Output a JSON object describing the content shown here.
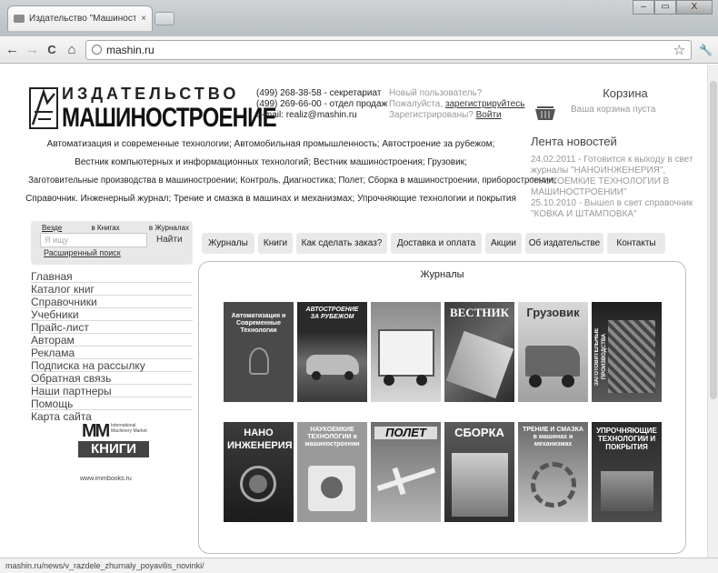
{
  "browser": {
    "tab_title": "Издательство \"Машиност",
    "tab_close": "×",
    "url": "mashin.ru",
    "status_url": "mashin.ru/news/v_razdele_zhurnaly_poyavilis_novinki/",
    "window_buttons": [
      "‒",
      "▭",
      "X"
    ]
  },
  "icons": {
    "back": "←",
    "forward": "→",
    "reload": "C",
    "home": "⌂",
    "star": "☆",
    "wrench": "🔧"
  },
  "header": {
    "logo_line1": "ИЗДАТЕЛЬСТВО",
    "logo_line2": "МАШИНОСТРОЕНИЕ",
    "phone1": "(499) 268-38-58 - секретариат",
    "phone2": "(499) 269-66-00 - отдел продаж",
    "email": "e-mail: realiz@mashin.ru",
    "new_user": "Новый пользователь?",
    "please": "Пожалуйста,",
    "register": "зарегистрируйтесь",
    "registered": "Зарегистрированы?",
    "login": "Войти"
  },
  "cart": {
    "title": "Корзина",
    "empty_text": "Ваша корзина пуста"
  },
  "news": {
    "title": "Лента новостей",
    "items": [
      "24.02.2011 - Готовится к выходу в свет журналы \"НАНОИНЖЕНЕРИЯ\", \"НАУКОЕМКИЕ ТЕХНОЛОГИИ В МАШИНОСТРОЕНИИ\"",
      "25.10.2010 - Вышел в свет справочник \"КОВКА И ШТАМПОВКА\""
    ]
  },
  "topics": [
    "Автоматизация и современные технологии; Автомобильная промышленность; Автостроение за рубежом;",
    "Вестник компьютерных и информационных технологий; Вестник машиностроения; Грузовик;",
    "Заготовительные производства в машиностроении; Контроль. Диагностика; Полет; Сборка в машиностроении, приборостроении;",
    "Справочник. Инженерный журнал; Трение и смазка в машинах и механизмах; Упрочняющие технологии и покрытия"
  ],
  "search": {
    "scope_all": "Везде",
    "scope_books": "в Книгах",
    "scope_journals": "в Журналах",
    "placeholder": "Я ищу",
    "button": "Найти",
    "advanced": "Расширенный поиск"
  },
  "nav_tabs": [
    "Журналы",
    "Книги",
    "Как сделать заказ?",
    "Доставка и оплата",
    "Акции",
    "Об издательстве",
    "Контакты"
  ],
  "menu": [
    "Главная",
    "Каталог книг",
    "Справочники",
    "Учебники",
    "Прайс-лист",
    "Авторам",
    "Реклама",
    "Подписка на рассылку",
    "Обратная связь",
    "Наши партнеры",
    "Помощь",
    "Карта сайта"
  ],
  "partner": {
    "mm": "MM",
    "mm_small": "International Machinery Market",
    "books": "КНИГИ",
    "url": "www.immbooks.ru"
  },
  "journals_panel": {
    "title": "Журналы",
    "covers": [
      {
        "title": "Автоматизация и Современные Технологии"
      },
      {
        "title": "АВТОСТРОЕНИЕ ЗА РУБЕЖОМ"
      },
      {
        "title": ""
      },
      {
        "title": "ВЕСТНИК"
      },
      {
        "title": "Грузовик"
      },
      {
        "title": "ЗАГОТОВИТЕЛЬНЫЕ ПРОИЗВОДСТВА"
      },
      {
        "title": "НАНО ИНЖЕНЕРИЯ"
      },
      {
        "title": "НАУКОЕМКИЕ ТЕХНОЛОГИИ в машиностроении"
      },
      {
        "title": "ПОЛЕТ"
      },
      {
        "title": "СБОРКА"
      },
      {
        "title": "ТРЕНИЕ И СМАЗКА в машинах и механизмах"
      },
      {
        "title": "УПРОЧНЯЮЩИЕ ТЕХНОЛОГИИ И ПОКРЫТИЯ"
      }
    ]
  },
  "colors": {
    "tab_bg": "#e9e9e9",
    "panel_border": "#bdbdbd",
    "muted_text": "#999999"
  }
}
